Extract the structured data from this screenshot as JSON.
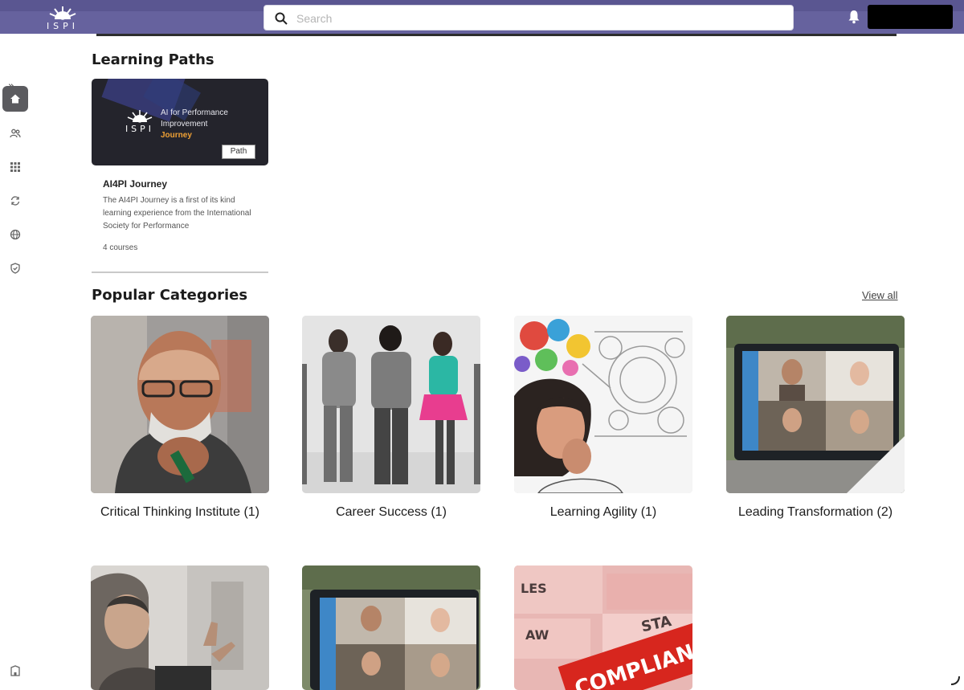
{
  "header": {
    "logo_text": "ISPI",
    "search_placeholder": "Search",
    "colors": {
      "bar": "#66629e",
      "bar_top": "#5a5691"
    }
  },
  "sidebar": {
    "expand_glyph": "»",
    "items": [
      {
        "icon": "home-icon",
        "active": true
      },
      {
        "icon": "people-icon",
        "active": false
      },
      {
        "icon": "grid-icon",
        "active": false
      },
      {
        "icon": "refresh-icon",
        "active": false
      },
      {
        "icon": "globe-icon",
        "active": false
      },
      {
        "icon": "shield-icon",
        "active": false
      }
    ],
    "bottom_icon": "building-icon"
  },
  "learning_paths": {
    "title": "Learning Paths",
    "cards": [
      {
        "banner_logo": "ISPI",
        "banner_text_1": "AI for Performance",
        "banner_text_2": "Improvement",
        "banner_text_3": "Journey",
        "badge": "Path",
        "name": "AI4PI Journey",
        "description": "The AI4PI Journey is a first of its kind learning experience from the International Society for Performance",
        "count": "4 courses"
      }
    ]
  },
  "popular_categories": {
    "title": "Popular Categories",
    "view_all": "View all",
    "items": [
      {
        "label": "Critical Thinking Institute (1)"
      },
      {
        "label": "Career Success (1)"
      },
      {
        "label": "Learning Agility (1)"
      },
      {
        "label": "Leading Transformation (2)"
      },
      {
        "label": ""
      },
      {
        "label": ""
      },
      {
        "label": ""
      }
    ],
    "partial_image_texts": [
      "LES",
      "AW",
      "STA",
      "COMPLIAN"
    ]
  }
}
